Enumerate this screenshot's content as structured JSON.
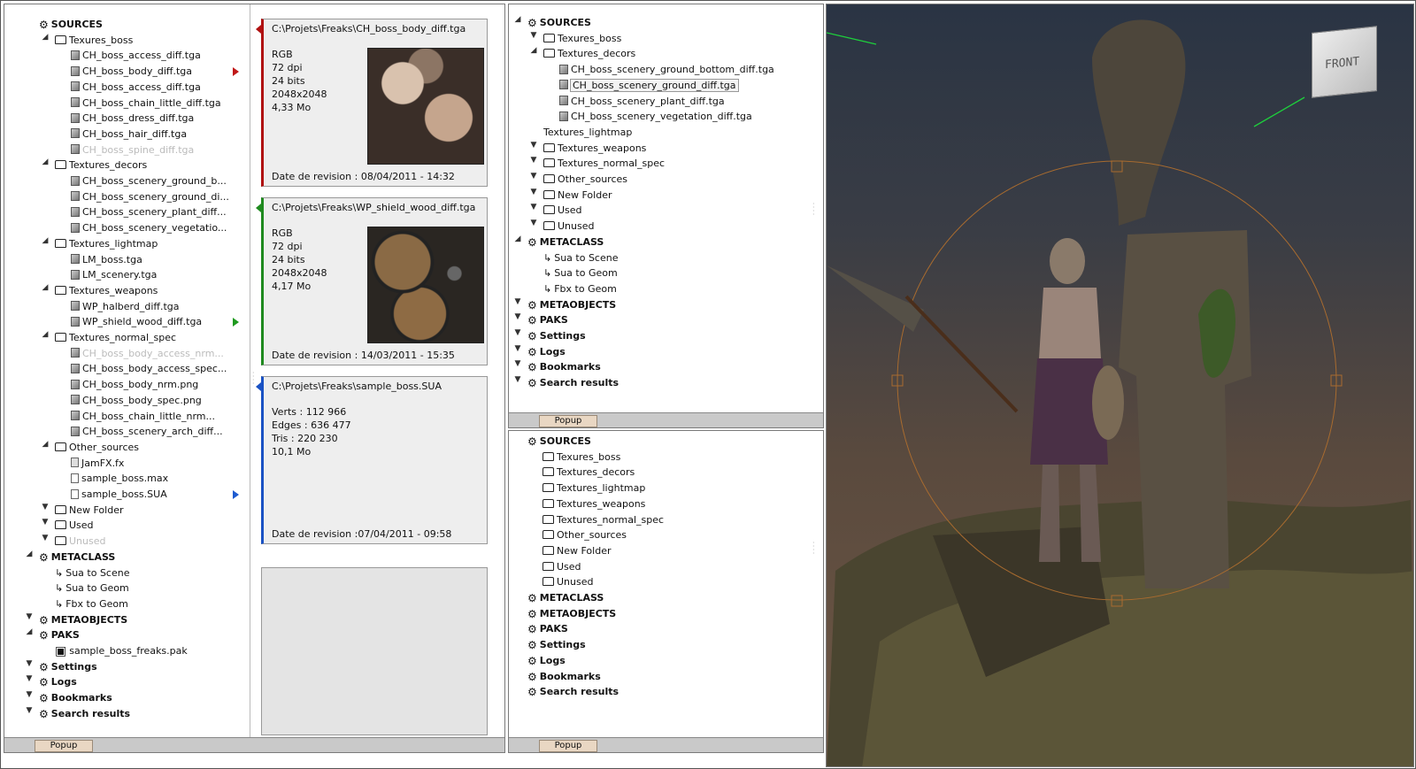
{
  "panel1": {
    "tree": [
      {
        "label": "SOURCES",
        "type": "root",
        "depth": 0,
        "exp": "none"
      },
      {
        "label": "Texures_boss",
        "type": "folder",
        "depth": 1,
        "exp": "open"
      },
      {
        "label": "CH_boss_access_diff.tga",
        "type": "file",
        "depth": 2
      },
      {
        "label": "CH_boss_body_diff.tga",
        "type": "file",
        "depth": 2,
        "marker": "red"
      },
      {
        "label": "CH_boss_access_diff.tga",
        "type": "file",
        "depth": 2
      },
      {
        "label": "CH_boss_chain_little_diff.tga",
        "type": "file",
        "depth": 2
      },
      {
        "label": "CH_boss_dress_diff.tga",
        "type": "file",
        "depth": 2
      },
      {
        "label": "CH_boss_hair_diff.tga",
        "type": "file",
        "depth": 2
      },
      {
        "label": "CH_boss_spine_diff.tga",
        "type": "file",
        "depth": 2,
        "faded": true
      },
      {
        "label": "Textures_decors",
        "type": "folder",
        "depth": 1,
        "exp": "open"
      },
      {
        "label": "CH_boss_scenery_ground_b...",
        "type": "file",
        "depth": 2
      },
      {
        "label": "CH_boss_scenery_ground_di...",
        "type": "file",
        "depth": 2
      },
      {
        "label": "CH_boss_scenery_plant_diff...",
        "type": "file",
        "depth": 2
      },
      {
        "label": "CH_boss_scenery_vegetatio...",
        "type": "file",
        "depth": 2
      },
      {
        "label": "Textures_lightmap",
        "type": "folder",
        "depth": 1,
        "exp": "open"
      },
      {
        "label": "LM_boss.tga",
        "type": "file",
        "depth": 2
      },
      {
        "label": "LM_scenery.tga",
        "type": "file",
        "depth": 2
      },
      {
        "label": "Textures_weapons",
        "type": "folder",
        "depth": 1,
        "exp": "open"
      },
      {
        "label": "WP_halberd_diff.tga",
        "type": "file",
        "depth": 2
      },
      {
        "label": "WP_shield_wood_diff.tga",
        "type": "file",
        "depth": 2,
        "marker": "green"
      },
      {
        "label": "Textures_normal_spec",
        "type": "folder",
        "depth": 1,
        "exp": "open"
      },
      {
        "label": "CH_boss_body_access_nrm...",
        "type": "file",
        "depth": 2,
        "faded": true
      },
      {
        "label": "CH_boss_body_access_spec...",
        "type": "file",
        "depth": 2
      },
      {
        "label": "CH_boss_body_nrm.png",
        "type": "file",
        "depth": 2
      },
      {
        "label": "CH_boss_body_spec.png",
        "type": "file",
        "depth": 2
      },
      {
        "label": "CH_boss_chain_little_nrm...",
        "type": "file",
        "depth": 2
      },
      {
        "label": "CH_boss_scenery_arch_diff...",
        "type": "file",
        "depth": 2
      },
      {
        "label": "Other_sources",
        "type": "folder",
        "depth": 1,
        "exp": "open"
      },
      {
        "label": "JamFX.fx",
        "type": "fx",
        "depth": 2
      },
      {
        "label": "sample_boss.max",
        "type": "doc",
        "depth": 2
      },
      {
        "label": "sample_boss.SUA",
        "type": "doc",
        "depth": 2,
        "marker": "blue"
      },
      {
        "label": "New Folder",
        "type": "folder",
        "depth": 1,
        "exp": "closed"
      },
      {
        "label": "Used",
        "type": "folder",
        "depth": 1,
        "exp": "closed"
      },
      {
        "label": "Unused",
        "type": "folder",
        "depth": 1,
        "exp": "closed",
        "faded": true
      },
      {
        "label": "METACLASS",
        "type": "root",
        "depth": 0,
        "exp": "open"
      },
      {
        "label": "Sua to Scene",
        "type": "link",
        "depth": 1
      },
      {
        "label": "Sua to Geom",
        "type": "link",
        "depth": 1
      },
      {
        "label": "Fbx to Geom",
        "type": "link",
        "depth": 1
      },
      {
        "label": "METAOBJECTS",
        "type": "root",
        "depth": 0,
        "exp": "closed"
      },
      {
        "label": "PAKS",
        "type": "root",
        "depth": 0,
        "exp": "open"
      },
      {
        "label": "sample_boss_freaks.pak",
        "type": "pak",
        "depth": 1
      },
      {
        "label": "Settings",
        "type": "root",
        "depth": 0,
        "exp": "closed"
      },
      {
        "label": "Logs",
        "type": "root",
        "depth": 0,
        "exp": "closed"
      },
      {
        "label": "Bookmarks",
        "type": "root",
        "depth": 0,
        "exp": "closed"
      },
      {
        "label": "Search results",
        "type": "root",
        "depth": 0,
        "exp": "closed"
      }
    ]
  },
  "cards": [
    {
      "path": "C:\\Projets\\Freaks\\CH_boss_body_diff.tga",
      "info": [
        "RGB",
        "72 dpi",
        "24 bits",
        "2048x2048",
        "4,33 Mo"
      ],
      "date": "Date de revision : 08/04/2011 - 14:32",
      "color": "#b01010",
      "thumb": "body"
    },
    {
      "path": "C:\\Projets\\Freaks\\WP_shield_wood_diff.tga",
      "info": [
        "RGB",
        "72 dpi",
        "24 bits",
        "2048x2048",
        "4,17 Mo"
      ],
      "date": "Date de revision : 14/03/2011 - 15:35",
      "color": "#1f8a1f",
      "thumb": "shield"
    },
    {
      "path": "C:\\Projets\\Freaks\\sample_boss.SUA",
      "info": [
        "Verts : 112 966",
        "Edges : 636 477",
        "Tris : 220 230",
        "10,1 Mo"
      ],
      "date": "Date de revision :07/04/2011 - 09:58",
      "color": "#1a52c4",
      "thumb": "none"
    }
  ],
  "panel2": {
    "tree": [
      {
        "label": "SOURCES",
        "type": "root",
        "depth": 0,
        "exp": "open"
      },
      {
        "label": "Texures_boss",
        "type": "folder",
        "depth": 1,
        "exp": "closed"
      },
      {
        "label": "Textures_decors",
        "type": "folder",
        "depth": 1,
        "exp": "open"
      },
      {
        "label": "CH_boss_scenery_ground_bottom_diff.tga",
        "type": "file",
        "depth": 2
      },
      {
        "label": "CH_boss_scenery_ground_diff.tga",
        "type": "file",
        "depth": 2,
        "selected": true
      },
      {
        "label": "CH_boss_scenery_plant_diff.tga",
        "type": "file",
        "depth": 2
      },
      {
        "label": "CH_boss_scenery_vegetation_diff.tga",
        "type": "file",
        "depth": 2
      },
      {
        "label": "Textures_lightmap",
        "type": "plain",
        "depth": 1
      },
      {
        "label": "Textures_weapons",
        "type": "folder",
        "depth": 1,
        "exp": "closed"
      },
      {
        "label": "Textures_normal_spec",
        "type": "folder",
        "depth": 1,
        "exp": "closed"
      },
      {
        "label": "Other_sources",
        "type": "folder",
        "depth": 1,
        "exp": "closed"
      },
      {
        "label": "New Folder",
        "type": "folder",
        "depth": 1,
        "exp": "closed"
      },
      {
        "label": "Used",
        "type": "folder",
        "depth": 1,
        "exp": "closed"
      },
      {
        "label": "Unused",
        "type": "folder",
        "depth": 1,
        "exp": "closed"
      },
      {
        "label": "METACLASS",
        "type": "root",
        "depth": 0,
        "exp": "open"
      },
      {
        "label": "Sua to Scene",
        "type": "link",
        "depth": 1
      },
      {
        "label": "Sua to Geom",
        "type": "link",
        "depth": 1
      },
      {
        "label": "Fbx to Geom",
        "type": "link",
        "depth": 1
      },
      {
        "label": "METAOBJECTS",
        "type": "root",
        "depth": 0,
        "exp": "closed"
      },
      {
        "label": "PAKS",
        "type": "root",
        "depth": 0,
        "exp": "closed"
      },
      {
        "label": "Settings",
        "type": "root",
        "depth": 0,
        "exp": "closed"
      },
      {
        "label": "Logs",
        "type": "root",
        "depth": 0,
        "exp": "closed"
      },
      {
        "label": "Bookmarks",
        "type": "root",
        "depth": 0,
        "exp": "closed"
      },
      {
        "label": "Search results",
        "type": "root",
        "depth": 0,
        "exp": "closed"
      }
    ]
  },
  "panel3": {
    "tree": [
      {
        "label": "SOURCES",
        "type": "root",
        "depth": 0,
        "exp": "none"
      },
      {
        "label": "Texures_boss",
        "type": "folder",
        "depth": 1,
        "exp": "none"
      },
      {
        "label": "Textures_decors",
        "type": "folder",
        "depth": 1,
        "exp": "none"
      },
      {
        "label": "Textures_lightmap",
        "type": "folder",
        "depth": 1,
        "exp": "none"
      },
      {
        "label": "Textures_weapons",
        "type": "folder",
        "depth": 1,
        "exp": "none"
      },
      {
        "label": "Textures_normal_spec",
        "type": "folder",
        "depth": 1,
        "exp": "none"
      },
      {
        "label": "Other_sources",
        "type": "folder",
        "depth": 1,
        "exp": "none"
      },
      {
        "label": "New Folder",
        "type": "folder",
        "depth": 1,
        "exp": "none"
      },
      {
        "label": "Used",
        "type": "folder",
        "depth": 1,
        "exp": "none"
      },
      {
        "label": "Unused",
        "type": "folder",
        "depth": 1,
        "exp": "none"
      },
      {
        "label": "METACLASS",
        "type": "root",
        "depth": 0,
        "exp": "none"
      },
      {
        "label": "METAOBJECTS",
        "type": "root",
        "depth": 0,
        "exp": "none"
      },
      {
        "label": "PAKS",
        "type": "root",
        "depth": 0,
        "exp": "none"
      },
      {
        "label": "Settings",
        "type": "root",
        "depth": 0,
        "exp": "none"
      },
      {
        "label": "Logs",
        "type": "root",
        "depth": 0,
        "exp": "none"
      },
      {
        "label": "Bookmarks",
        "type": "root",
        "depth": 0,
        "exp": "none"
      },
      {
        "label": "Search results",
        "type": "root",
        "depth": 0,
        "exp": "none"
      }
    ]
  },
  "popup_label": "Popup",
  "viewport": {
    "cube_label": "FRONT"
  },
  "icons": {
    "root": "gear-icon",
    "folder": "folder-icon",
    "file": "image-file-icon",
    "doc": "document-icon",
    "fx": "fx-file-icon",
    "link": "link-icon",
    "pak": "package-icon"
  }
}
